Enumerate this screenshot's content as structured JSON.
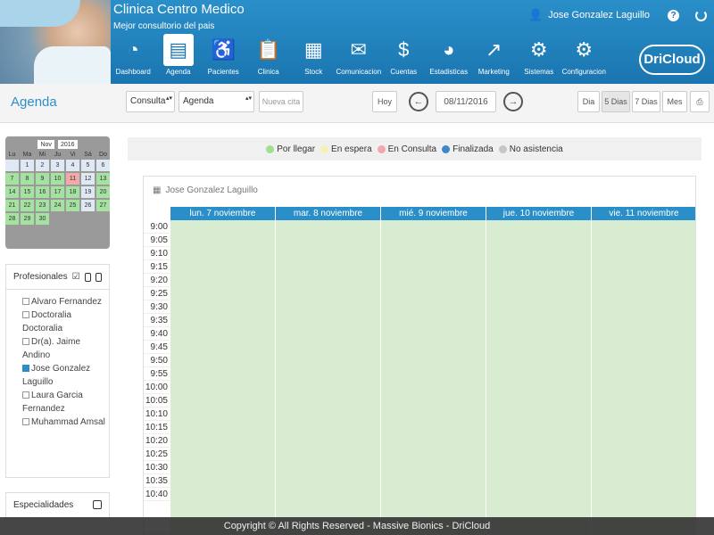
{
  "header": {
    "clinic_name": "Clinica Centro Medico",
    "subtitle": "Mejor consultorio del pais",
    "user_name": "Jose Gonzalez Laguillo",
    "help_glyph": "?",
    "logo_text": "DriCloud",
    "nav": [
      {
        "label": "Dashboard",
        "icon": "gauge-icon",
        "glyph": "◔"
      },
      {
        "label": "Agenda",
        "icon": "agenda-icon",
        "glyph": "▤",
        "active": true
      },
      {
        "label": "Pacientes",
        "icon": "wheelchair-icon",
        "glyph": "♿"
      },
      {
        "label": "Clinica",
        "icon": "clipboard-icon",
        "glyph": "📋"
      },
      {
        "label": "Stock",
        "icon": "boxes-icon",
        "glyph": "▦"
      },
      {
        "label": "Comunicacion",
        "icon": "chat-icon",
        "glyph": "✉"
      },
      {
        "label": "Cuentas",
        "icon": "money-icon",
        "glyph": "$"
      },
      {
        "label": "Estadisticas",
        "icon": "pie-chart-icon",
        "glyph": "◕"
      },
      {
        "label": "Marketing",
        "icon": "line-chart-icon",
        "glyph": "↗"
      },
      {
        "label": "Sistemas",
        "icon": "user-gear-icon",
        "glyph": "⚙"
      },
      {
        "label": "Configuracion",
        "icon": "gear-icon",
        "glyph": "⚙"
      }
    ]
  },
  "toolbar": {
    "title": "Agenda",
    "view_select": "Consulta",
    "agenda_select": "Agenda",
    "new_appt": "Nueva cita",
    "today": "Hoy",
    "date": "08/11/2016",
    "views": [
      "Dia",
      "5 Dias",
      "7 Dias",
      "Mes"
    ]
  },
  "mini_calendar": {
    "month": "Nov",
    "year": "2016",
    "weekdays": [
      "Lu",
      "Ma",
      "Mi",
      "Ju",
      "Vi",
      "Sá",
      "Do"
    ],
    "days": [
      {
        "d": "",
        "c": "b"
      },
      {
        "d": "1",
        "c": "b"
      },
      {
        "d": "2",
        "c": "b"
      },
      {
        "d": "3",
        "c": "b"
      },
      {
        "d": "4",
        "c": "b"
      },
      {
        "d": "5",
        "c": "b"
      },
      {
        "d": "6",
        "c": "b"
      },
      {
        "d": "7",
        "c": "g"
      },
      {
        "d": "8",
        "c": "g"
      },
      {
        "d": "9",
        "c": "g"
      },
      {
        "d": "10",
        "c": "g"
      },
      {
        "d": "11",
        "c": "r"
      },
      {
        "d": "12",
        "c": "b"
      },
      {
        "d": "13",
        "c": "g"
      },
      {
        "d": "14",
        "c": "g"
      },
      {
        "d": "15",
        "c": "g"
      },
      {
        "d": "16",
        "c": "g"
      },
      {
        "d": "17",
        "c": "g"
      },
      {
        "d": "18",
        "c": "g"
      },
      {
        "d": "19",
        "c": "b"
      },
      {
        "d": "20",
        "c": "g"
      },
      {
        "d": "21",
        "c": "g"
      },
      {
        "d": "22",
        "c": "g"
      },
      {
        "d": "23",
        "c": "g"
      },
      {
        "d": "24",
        "c": "g"
      },
      {
        "d": "25",
        "c": "g"
      },
      {
        "d": "26",
        "c": "b"
      },
      {
        "d": "27",
        "c": "g"
      },
      {
        "d": "28",
        "c": "g"
      },
      {
        "d": "29",
        "c": "g"
      },
      {
        "d": "30",
        "c": "g"
      }
    ]
  },
  "professionals": {
    "title": "Profesionales",
    "items": [
      {
        "name": "Alvaro Fernandez",
        "checked": false
      },
      {
        "name": "Doctoralia Doctoralia",
        "checked": false
      },
      {
        "name": "Dr(a). Jaime Andino",
        "checked": false
      },
      {
        "name": "Jose Gonzalez Laguillo",
        "checked": true
      },
      {
        "name": "Laura Garcia Fernandez",
        "checked": false
      },
      {
        "name": "Muhammad Amsal",
        "checked": false
      }
    ]
  },
  "specialties": {
    "title": "Especialidades"
  },
  "legend": [
    {
      "label": "Por llegar",
      "color": "#9ee08f"
    },
    {
      "label": "En espera",
      "color": "#f3f0b8"
    },
    {
      "label": "En Consulta",
      "color": "#f2a6ad"
    },
    {
      "label": "Finalizada",
      "color": "#3e87c8"
    },
    {
      "label": "No asistencia",
      "color": "#c6c6c6"
    }
  ],
  "calendar": {
    "doctor": "Jose Gonzalez Laguillo",
    "days": [
      "lun. 7 noviembre",
      "mar. 8 noviembre",
      "mié. 9 noviembre",
      "jue. 10 noviembre",
      "vie. 11 noviembre"
    ],
    "times": [
      "9:00",
      "9:05",
      "9:10",
      "9:15",
      "9:20",
      "9:25",
      "9:30",
      "9:35",
      "9:40",
      "9:45",
      "9:50",
      "9:55",
      "10:00",
      "10:05",
      "10:10",
      "10:15",
      "10:20",
      "10:25",
      "10:30",
      "10:35",
      "10:40"
    ]
  },
  "footer": "Copyright © All Rights Reserved - Massive Bionics - DriCloud"
}
